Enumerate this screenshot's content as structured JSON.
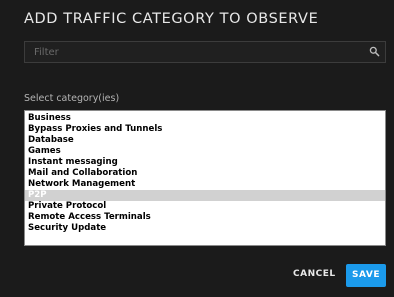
{
  "dialog": {
    "title": "ADD TRAFFIC CATEGORY TO OBSERVE",
    "filter": {
      "placeholder": "Filter",
      "value": "",
      "icon": "search-icon"
    },
    "select_label": "Select category(ies)",
    "categories": [
      "Business",
      "Bypass Proxies and Tunnels",
      "Database",
      "Games",
      "Instant messaging",
      "Mail and Collaboration",
      "Network Management",
      "P2P",
      "Private Protocol",
      "Remote Access Terminals",
      "Security Update"
    ],
    "selected": "P2P",
    "cancel_label": "CANCEL",
    "save_label": "SAVE"
  },
  "colors": {
    "background": "#1b1b1b",
    "accent": "#1b9aeb",
    "selection": "#d1d1d1"
  }
}
